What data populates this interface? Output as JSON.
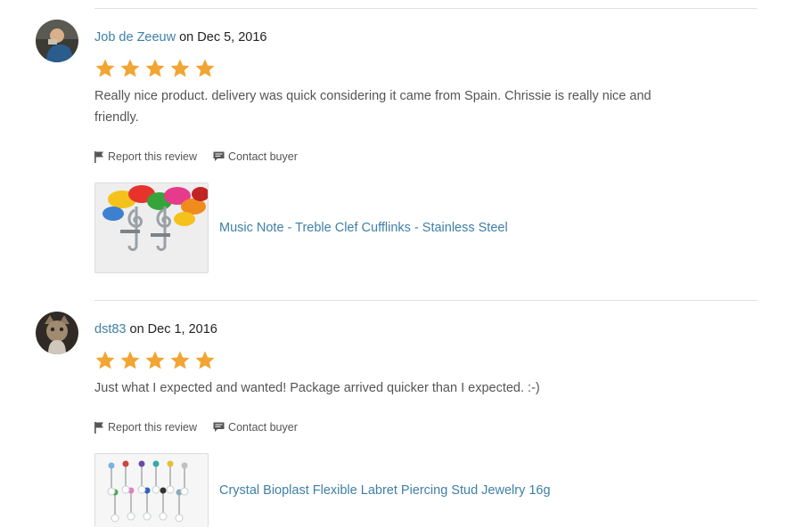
{
  "reviews": [
    {
      "username": "Job de Zeeuw",
      "date_text": " on Dec 5, 2016",
      "rating": 5,
      "text": "Really nice product. delivery was quick considering it came from Spain. Chrissie is really nice and friendly.",
      "report_label": "Report this review",
      "contact_label": "Contact buyer",
      "product_title": "Music Note - Treble Clef Cufflinks - Stainless Steel"
    },
    {
      "username": "dst83",
      "date_text": " on Dec 1, 2016",
      "rating": 5,
      "text": "Just what I expected and wanted! Package arrived quicker than I expected. :-)",
      "report_label": "Report this review",
      "contact_label": "Contact buyer",
      "product_title": "Crystal Bioplast Flexible Labret Piercing Stud Jewelry 16g"
    }
  ],
  "colors": {
    "link": "#3f7fa6",
    "star": "#f1a533",
    "divider": "#e1e1e1"
  },
  "icons": {
    "flag": "flag-icon",
    "contact": "message-icon",
    "star": "star-icon"
  }
}
